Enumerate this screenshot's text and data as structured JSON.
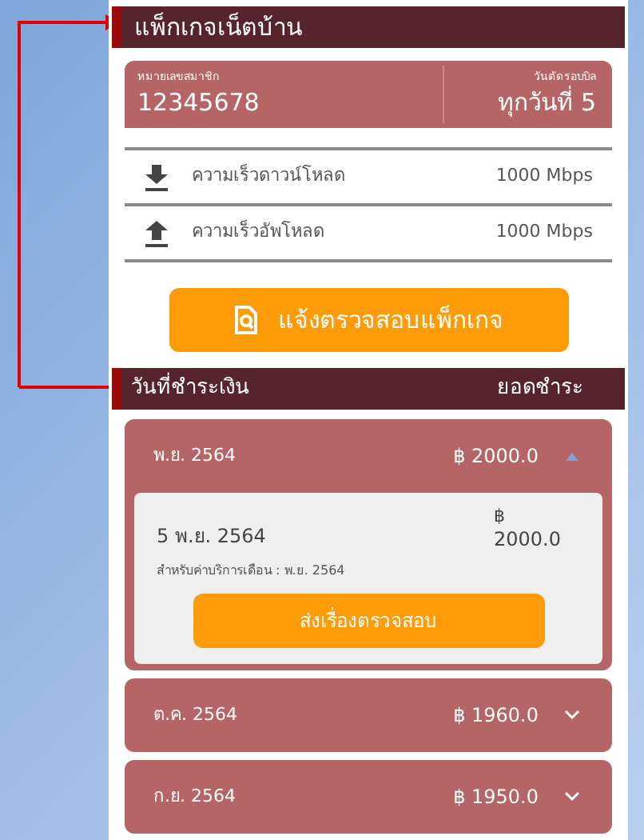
{
  "header": {
    "title": "แพ็กเกจเน็ตบ้าน"
  },
  "member_card": {
    "member_label": "หมายเลขสมาชิก",
    "member_number": "12345678",
    "cycle_label": "วันตัดรอบบิล",
    "cycle_value": "ทุกวันที่ 5"
  },
  "speeds": [
    {
      "kind": "download",
      "label": "ความเร็วดาวน์โหลด",
      "value": "1000 Mbps"
    },
    {
      "kind": "upload",
      "label": "ความเร็วอัพโหลด",
      "value": "1000 Mbps"
    }
  ],
  "check_button": {
    "label": "แจ้งตรวจสอบแพ็กเกจ"
  },
  "payments_header": {
    "date_column": "วันที่ชำระเงิน",
    "amount_column": "ยอดชำระ"
  },
  "payments": [
    {
      "month": "พ.ย. 2564",
      "amount": "฿ 2000.0",
      "expanded": true,
      "detail": {
        "date": "5 พ.ย. 2564",
        "currency": "฿",
        "amount": "2000.0",
        "note": "สำหรับค่าบริการเดือน : พ.ย. 2564",
        "button": "ส่งเรื่องตรวจสอบ"
      }
    },
    {
      "month": "ต.ค. 2564",
      "amount": "฿ 1960.0",
      "expanded": false
    },
    {
      "month": "ก.ย. 2564",
      "amount": "฿ 1950.0",
      "expanded": false
    }
  ]
}
